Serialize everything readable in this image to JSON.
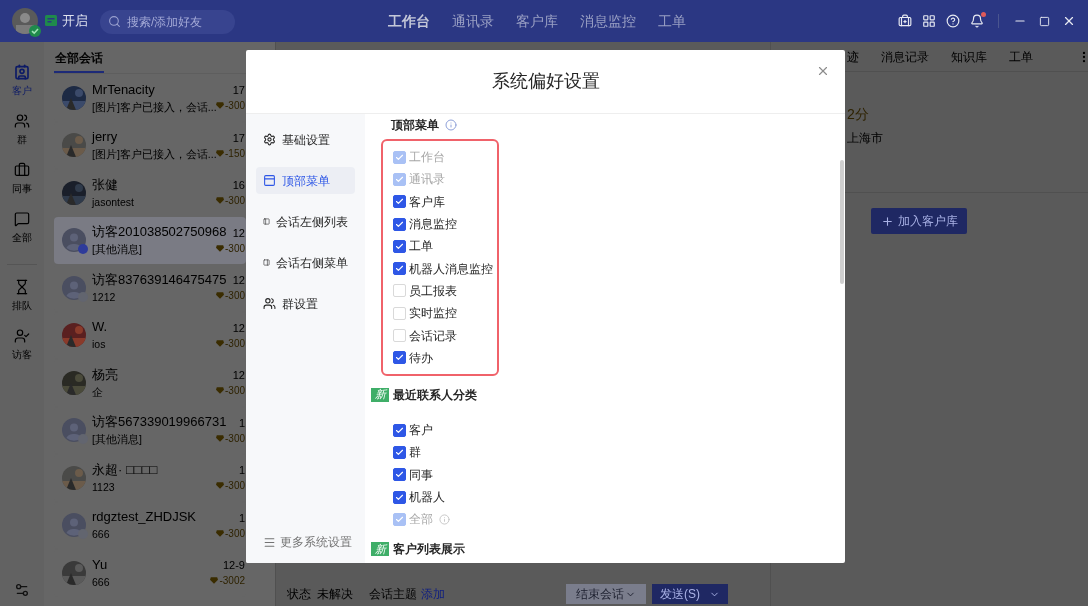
{
  "top_bar": {
    "status_label": "开启",
    "search": {
      "placeholder": "搜索/添加好友"
    },
    "nav": [
      {
        "label": "工作台",
        "selected": true
      },
      {
        "label": "通讯录",
        "selected": false
      },
      {
        "label": "客户库",
        "selected": false
      },
      {
        "label": "消息监控",
        "selected": false
      },
      {
        "label": "工单",
        "selected": false
      }
    ]
  },
  "left_nav": [
    {
      "label": "客户",
      "selected": true
    },
    {
      "label": "群",
      "selected": false
    },
    {
      "label": "同事",
      "selected": false
    },
    {
      "label": "全部",
      "selected": false
    },
    {
      "label": "排队",
      "selected": false
    },
    {
      "label": "访客",
      "selected": false
    }
  ],
  "conversation_list": {
    "tab": "全部会话",
    "rows": [
      {
        "name": "MrTenacity",
        "preview": "[图片]客户已接入，会话...",
        "time": "17",
        "badge": "-300",
        "selected": false
      },
      {
        "name": "jerry",
        "preview": "[图片]客户已接入，会话...",
        "time": "17",
        "badge": "-150",
        "selected": false
      },
      {
        "name": "张健",
        "preview": "jasontest",
        "time": "16",
        "badge": "-300",
        "selected": false
      },
      {
        "name": "访客201038502750968",
        "preview": "[其他消息]",
        "time": "12",
        "badge": "-300",
        "kind": "visitor",
        "selected": true
      },
      {
        "name": "访客837639146475475",
        "preview": "1212",
        "time": "12",
        "badge": "-300",
        "kind": "visitor",
        "selected": false
      },
      {
        "name": "W.",
        "preview": "ios",
        "time": "12",
        "badge": "-300",
        "selected": false
      },
      {
        "name": "杨亮",
        "preview": "企",
        "time": "12",
        "badge": "-300",
        "selected": false
      },
      {
        "name": "访客567339019966731",
        "preview": "[其他消息]",
        "time": "1",
        "badge": "-300",
        "kind": "visitor",
        "selected": false
      },
      {
        "name": "永超· □□□□",
        "preview": "1123",
        "time": "1",
        "badge": "-300",
        "selected": false
      },
      {
        "name": "rdgztest_ZHDJSK",
        "preview": "666",
        "time": "1",
        "badge": "-300",
        "kind": "visitor",
        "selected": false
      },
      {
        "name": "Yu",
        "preview": "666",
        "time": "12-9",
        "badge": "-3002",
        "selected": false
      }
    ]
  },
  "chat_footer": {
    "status_label": "状态",
    "status": "未解决",
    "topic_label": "会话主题",
    "topic_action": "添加",
    "end_button": "结束会话",
    "send_button": "发送(S)"
  },
  "right_panel": {
    "tabs": [
      "迹",
      "消息记录",
      "知识库",
      "工单"
    ],
    "score": "2分",
    "location": "上海市",
    "add_button": "加入客户库"
  },
  "dialog": {
    "title": "系统偏好设置",
    "nav": [
      {
        "label": "基础设置",
        "selected": false
      },
      {
        "label": "顶部菜单",
        "selected": true
      },
      {
        "label": "会话左侧列表",
        "selected": false
      },
      {
        "label": "会话右侧菜单",
        "selected": false
      },
      {
        "label": "群设置",
        "selected": false
      }
    ],
    "more": "更多系统设置",
    "sections": [
      {
        "title": "顶部菜单",
        "info": true,
        "highlighted": true,
        "options": [
          {
            "label": "工作台",
            "checked": true,
            "disabled": true
          },
          {
            "label": "通讯录",
            "checked": true,
            "disabled": true
          },
          {
            "label": "客户库",
            "checked": true,
            "disabled": false
          },
          {
            "label": "消息监控",
            "checked": true,
            "disabled": false
          },
          {
            "label": "工单",
            "checked": true,
            "disabled": false
          },
          {
            "label": "机器人消息监控",
            "checked": true,
            "disabled": false
          },
          {
            "label": "员工报表",
            "checked": false,
            "disabled": false
          },
          {
            "label": "实时监控",
            "checked": false,
            "disabled": false
          },
          {
            "label": "会话记录",
            "checked": false,
            "disabled": false
          },
          {
            "label": "待办",
            "checked": true,
            "disabled": false
          }
        ]
      },
      {
        "title": "最近联系人分类",
        "badge": "新",
        "options": [
          {
            "label": "客户",
            "checked": true,
            "disabled": false
          },
          {
            "label": "群",
            "checked": true,
            "disabled": false
          },
          {
            "label": "同事",
            "checked": true,
            "disabled": false
          },
          {
            "label": "机器人",
            "checked": true,
            "disabled": false
          },
          {
            "label": "全部",
            "checked": true,
            "disabled": true,
            "info": true
          }
        ]
      },
      {
        "title": "客户列表展示",
        "badge": "新"
      }
    ]
  }
}
